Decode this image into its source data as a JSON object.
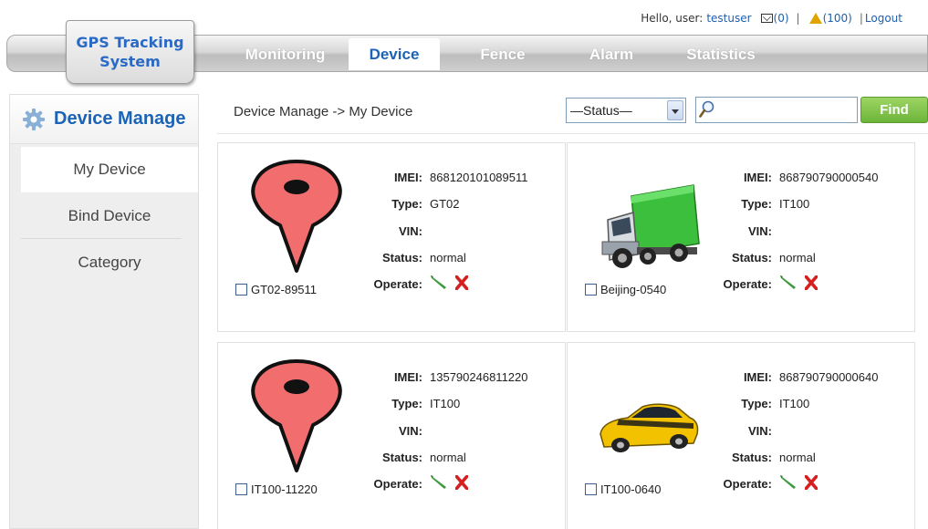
{
  "user_bar": {
    "greeting": "Hello, user:",
    "username": "testuser",
    "mail_count": "(0)",
    "alarm_count": "(100)",
    "logout": "Logout",
    "separator": "|"
  },
  "logo": {
    "line1": "GPS Tracking",
    "line2": "System"
  },
  "nav": {
    "tabs": [
      {
        "label": "Monitoring",
        "active": false
      },
      {
        "label": "Device",
        "active": true
      },
      {
        "label": "Fence",
        "active": false
      },
      {
        "label": "Alarm",
        "active": false
      },
      {
        "label": "Statistics",
        "active": false
      }
    ]
  },
  "sidebar": {
    "title": "Device Manage",
    "items": [
      {
        "label": "My Device",
        "active": true
      },
      {
        "label": "Bind Device",
        "active": false
      },
      {
        "label": "Category",
        "active": false
      }
    ]
  },
  "main": {
    "breadcrumb": "Device Manage -> My Device",
    "status_select": {
      "value": "—Status—"
    },
    "search": {
      "value": ""
    },
    "find_button": "Find"
  },
  "labels": {
    "imei": "IMEI:",
    "type": "Type:",
    "vin": "VIN:",
    "status": "Status:",
    "operate": "Operate:"
  },
  "devices": [
    {
      "name": "GT02-89511",
      "imei": "868120101089511",
      "type": "GT02",
      "vin": "",
      "status": "normal",
      "icon": "map-pin-icon"
    },
    {
      "name": "Beijing-0540",
      "imei": "868790790000540",
      "type": "IT100",
      "vin": "",
      "status": "normal",
      "icon": "truck-icon"
    },
    {
      "name": "IT100-11220",
      "imei": "135790246811220",
      "type": "IT100",
      "vin": "",
      "status": "normal",
      "icon": "map-pin-icon"
    },
    {
      "name": "IT100-0640",
      "imei": "868790790000640",
      "type": "IT100",
      "vin": "",
      "status": "normal",
      "icon": "car-icon"
    }
  ],
  "colors": {
    "accent_blue": "#1b63b6",
    "find_green": "#7cc143",
    "pin_red": "#f26d6d",
    "truck_green": "#3cbf3c",
    "car_yellow": "#f2c200",
    "delete_red": "#d62020"
  }
}
